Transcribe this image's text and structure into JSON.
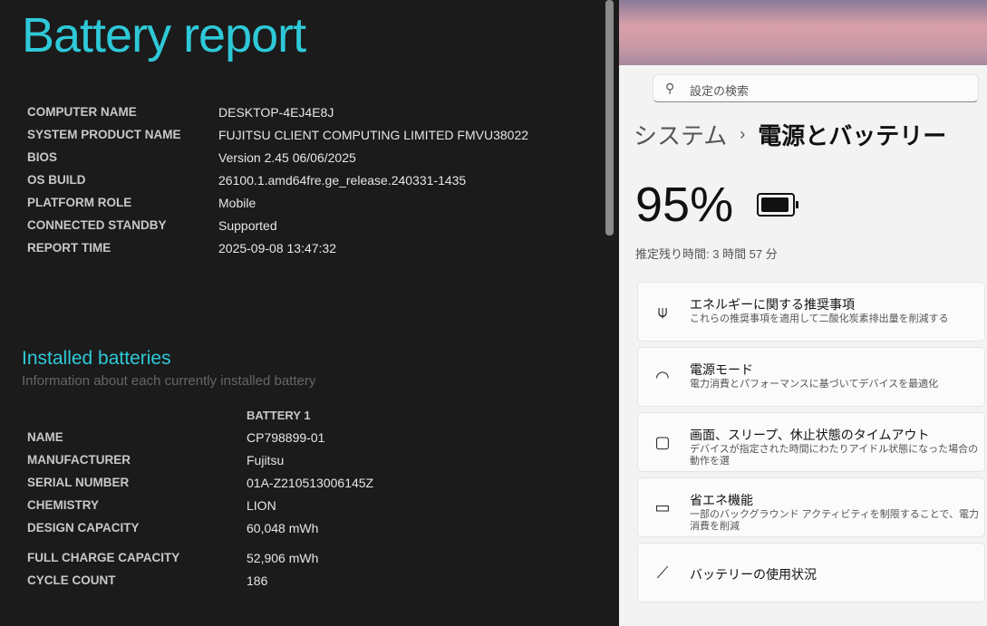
{
  "report": {
    "title": "Battery report",
    "info": [
      {
        "k": "COMPUTER NAME",
        "v": "DESKTOP-4EJ4E8J"
      },
      {
        "k": "SYSTEM PRODUCT NAME",
        "v": "FUJITSU CLIENT COMPUTING LIMITED FMVU38022"
      },
      {
        "k": "BIOS",
        "v": "Version 2.45 06/06/2025"
      },
      {
        "k": "OS BUILD",
        "v": "26100.1.amd64fre.ge_release.240331-1435"
      },
      {
        "k": "PLATFORM ROLE",
        "v": "Mobile"
      },
      {
        "k": "CONNECTED STANDBY",
        "v": "Supported"
      },
      {
        "k": "REPORT TIME",
        "v": "2025-09-08  13:47:32"
      }
    ],
    "installed_title": "Installed batteries",
    "installed_sub": "Information about each currently installed battery",
    "battery_header": "BATTERY 1",
    "battery": [
      {
        "k": "NAME",
        "v": "CP798899-01"
      },
      {
        "k": "MANUFACTURER",
        "v": "Fujitsu"
      },
      {
        "k": "SERIAL NUMBER",
        "v": "01A-Z210513006145Z"
      },
      {
        "k": "CHEMISTRY",
        "v": "LION"
      },
      {
        "k": "DESIGN CAPACITY",
        "v": "60,048 mWh"
      },
      {
        "k": "FULL CHARGE CAPACITY",
        "v": "52,906 mWh"
      },
      {
        "k": "CYCLE COUNT",
        "v": "186"
      }
    ]
  },
  "settings": {
    "search_placeholder": "設定の検索",
    "breadcrumb_parent": "システム",
    "breadcrumb_sep": "›",
    "breadcrumb_current": "電源とバッテリー",
    "percent": "95%",
    "battery_level": 0.95,
    "estimate": "推定残り時間: 3 時間 57 分",
    "cards": [
      {
        "icon": "leaf-icon",
        "glyph": "⍦",
        "title": "エネルギーに関する推奨事項",
        "desc": "これらの推奨事項を適用して二酸化炭素排出量を削減する"
      },
      {
        "icon": "gauge-icon",
        "glyph": "◠",
        "title": "電源モード",
        "desc": "電力消費とパフォーマンスに基づいてデバイスを最適化"
      },
      {
        "icon": "screen-sleep-icon",
        "glyph": "▢",
        "title": "画面、スリープ、休止状態のタイムアウト",
        "desc": "デバイスが指定された時間にわたりアイドル状態になった場合の動作を選"
      },
      {
        "icon": "battery-saver-icon",
        "glyph": "▭",
        "title": "省エネ機能",
        "desc": "一部のバックグラウンド アクティビティを制限することで、電力消費を削減"
      },
      {
        "icon": "chart-icon",
        "glyph": "⟋",
        "title": "バッテリーの使用状況",
        "desc": ""
      }
    ]
  }
}
